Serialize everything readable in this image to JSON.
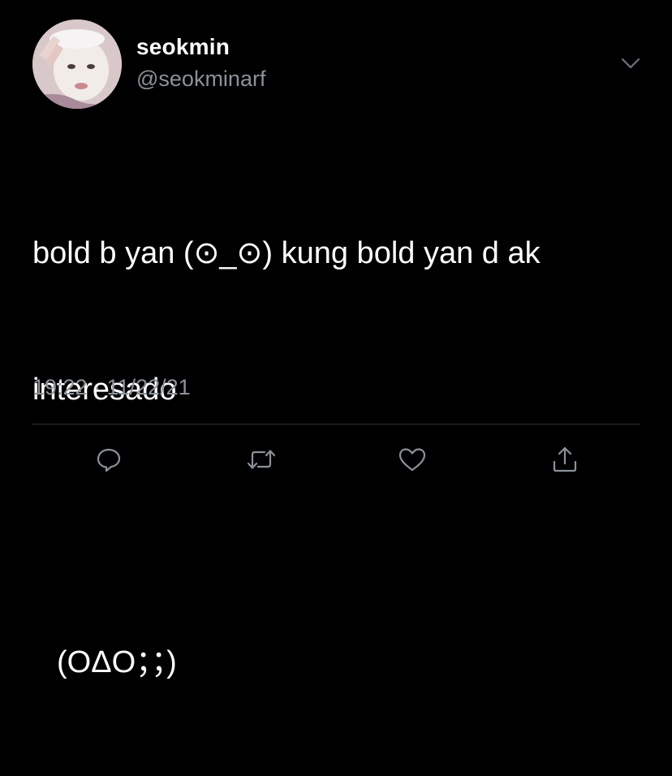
{
  "user": {
    "display_name": "seokmin",
    "handle": "@seokminarf",
    "avatar_icon": "profile-photo"
  },
  "tweet": {
    "text_lines": [
      "bold b yan (⊙_⊙) kung bold yan d ak",
      "interesado",
      "",
      "(OΔO；；)"
    ],
    "timestamp": "19:22 · 11/22/21"
  },
  "actions": [
    {
      "name": "reply",
      "icon": "speech-bubble-icon"
    },
    {
      "name": "retweet",
      "icon": "retweet-arrows-icon"
    },
    {
      "name": "like",
      "icon": "heart-icon"
    },
    {
      "name": "share",
      "icon": "share-upload-icon"
    }
  ],
  "colors": {
    "background": "#000000",
    "text_primary": "#ffffff",
    "text_secondary": "#8b9299",
    "divider": "#2f3336"
  }
}
